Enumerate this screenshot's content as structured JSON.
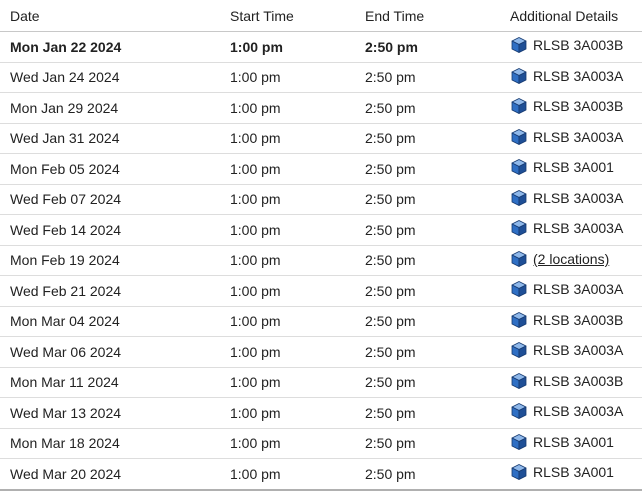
{
  "headers": {
    "date": "Date",
    "start": "Start Time",
    "end": "End Time",
    "details": "Additional Details"
  },
  "icon": "building-cube-icon",
  "colors": {
    "cube_top": "#8fb8ea",
    "cube_left": "#2f6fc4",
    "cube_right": "#1f4f96",
    "cube_outline": "#163a70"
  },
  "rows": [
    {
      "date": "Mon Jan 22 2024",
      "start": "1:00 pm",
      "end": "2:50 pm",
      "location": "RLSB 3A003B",
      "current": true,
      "link": false
    },
    {
      "date": "Wed Jan 24 2024",
      "start": "1:00 pm",
      "end": "2:50 pm",
      "location": "RLSB 3A003A",
      "current": false,
      "link": false
    },
    {
      "date": "Mon Jan 29 2024",
      "start": "1:00 pm",
      "end": "2:50 pm",
      "location": "RLSB 3A003B",
      "current": false,
      "link": false
    },
    {
      "date": "Wed Jan 31 2024",
      "start": "1:00 pm",
      "end": "2:50 pm",
      "location": "RLSB 3A003A",
      "current": false,
      "link": false
    },
    {
      "date": "Mon Feb 05 2024",
      "start": "1:00 pm",
      "end": "2:50 pm",
      "location": "RLSB 3A001",
      "current": false,
      "link": false
    },
    {
      "date": "Wed Feb 07 2024",
      "start": "1:00 pm",
      "end": "2:50 pm",
      "location": "RLSB 3A003A",
      "current": false,
      "link": false
    },
    {
      "date": "Wed Feb 14 2024",
      "start": "1:00 pm",
      "end": "2:50 pm",
      "location": "RLSB 3A003A",
      "current": false,
      "link": false
    },
    {
      "date": "Mon Feb 19 2024",
      "start": "1:00 pm",
      "end": "2:50 pm",
      "location": "(2 locations)",
      "current": false,
      "link": true
    },
    {
      "date": "Wed Feb 21 2024",
      "start": "1:00 pm",
      "end": "2:50 pm",
      "location": "RLSB 3A003A",
      "current": false,
      "link": false
    },
    {
      "date": "Mon Mar 04 2024",
      "start": "1:00 pm",
      "end": "2:50 pm",
      "location": "RLSB 3A003B",
      "current": false,
      "link": false
    },
    {
      "date": "Wed Mar 06 2024",
      "start": "1:00 pm",
      "end": "2:50 pm",
      "location": "RLSB 3A003A",
      "current": false,
      "link": false
    },
    {
      "date": "Mon Mar 11 2024",
      "start": "1:00 pm",
      "end": "2:50 pm",
      "location": "RLSB 3A003B",
      "current": false,
      "link": false
    },
    {
      "date": "Wed Mar 13 2024",
      "start": "1:00 pm",
      "end": "2:50 pm",
      "location": "RLSB 3A003A",
      "current": false,
      "link": false
    },
    {
      "date": "Mon Mar 18 2024",
      "start": "1:00 pm",
      "end": "2:50 pm",
      "location": "RLSB 3A001",
      "current": false,
      "link": false
    },
    {
      "date": "Wed Mar 20 2024",
      "start": "1:00 pm",
      "end": "2:50 pm",
      "location": "RLSB 3A001",
      "current": false,
      "link": false
    }
  ]
}
